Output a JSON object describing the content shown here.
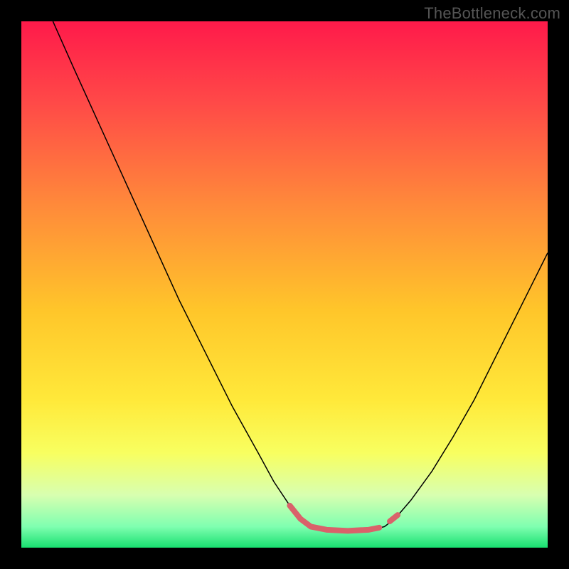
{
  "watermark": "TheBottleneck.com",
  "chart_data": {
    "type": "line",
    "title": "",
    "xlabel": "",
    "ylabel": "",
    "xlim": [
      0,
      100
    ],
    "ylim": [
      0,
      100
    ],
    "background_gradient": {
      "stops": [
        {
          "offset": 0.0,
          "color": "#ff1a4a"
        },
        {
          "offset": 0.15,
          "color": "#ff4848"
        },
        {
          "offset": 0.35,
          "color": "#ff8a3a"
        },
        {
          "offset": 0.55,
          "color": "#ffc62a"
        },
        {
          "offset": 0.72,
          "color": "#ffe93a"
        },
        {
          "offset": 0.82,
          "color": "#f8ff60"
        },
        {
          "offset": 0.9,
          "color": "#d8ffb0"
        },
        {
          "offset": 0.96,
          "color": "#7fffb0"
        },
        {
          "offset": 1.0,
          "color": "#18e070"
        }
      ]
    },
    "series": [
      {
        "name": "left-curve",
        "color": "#000000",
        "width": 1.5,
        "values": [
          {
            "x": 6.0,
            "y": 100.0
          },
          {
            "x": 10.0,
            "y": 91.0
          },
          {
            "x": 15.0,
            "y": 80.0
          },
          {
            "x": 20.0,
            "y": 69.0
          },
          {
            "x": 25.0,
            "y": 58.0
          },
          {
            "x": 30.0,
            "y": 47.0
          },
          {
            "x": 35.0,
            "y": 37.0
          },
          {
            "x": 40.0,
            "y": 27.0
          },
          {
            "x": 45.0,
            "y": 18.0
          },
          {
            "x": 48.0,
            "y": 12.5
          },
          {
            "x": 51.0,
            "y": 8.0
          },
          {
            "x": 53.0,
            "y": 5.5
          },
          {
            "x": 55.0,
            "y": 4.0
          },
          {
            "x": 58.0,
            "y": 3.2
          },
          {
            "x": 62.0,
            "y": 3.0
          },
          {
            "x": 66.0,
            "y": 3.2
          },
          {
            "x": 69.0,
            "y": 4.0
          },
          {
            "x": 71.0,
            "y": 5.5
          }
        ]
      },
      {
        "name": "right-curve",
        "color": "#000000",
        "width": 1.5,
        "values": [
          {
            "x": 71.0,
            "y": 5.5
          },
          {
            "x": 74.0,
            "y": 9.0
          },
          {
            "x": 78.0,
            "y": 14.5
          },
          {
            "x": 82.0,
            "y": 21.0
          },
          {
            "x": 86.0,
            "y": 28.0
          },
          {
            "x": 90.0,
            "y": 36.0
          },
          {
            "x": 94.0,
            "y": 44.0
          },
          {
            "x": 98.0,
            "y": 52.0
          },
          {
            "x": 100.0,
            "y": 56.0
          }
        ]
      },
      {
        "name": "highlight-bottom",
        "color": "#d9626a",
        "width": 8,
        "linecap": "round",
        "values": [
          {
            "x": 51.0,
            "y": 8.0
          },
          {
            "x": 53.0,
            "y": 5.5
          },
          {
            "x": 55.0,
            "y": 4.0
          },
          {
            "x": 58.0,
            "y": 3.4
          },
          {
            "x": 62.0,
            "y": 3.2
          },
          {
            "x": 66.0,
            "y": 3.4
          },
          {
            "x": 68.0,
            "y": 3.8
          }
        ]
      },
      {
        "name": "highlight-right",
        "color": "#d9626a",
        "width": 8,
        "linecap": "round",
        "values": [
          {
            "x": 70.0,
            "y": 5.0
          },
          {
            "x": 71.5,
            "y": 6.2
          }
        ]
      }
    ]
  }
}
